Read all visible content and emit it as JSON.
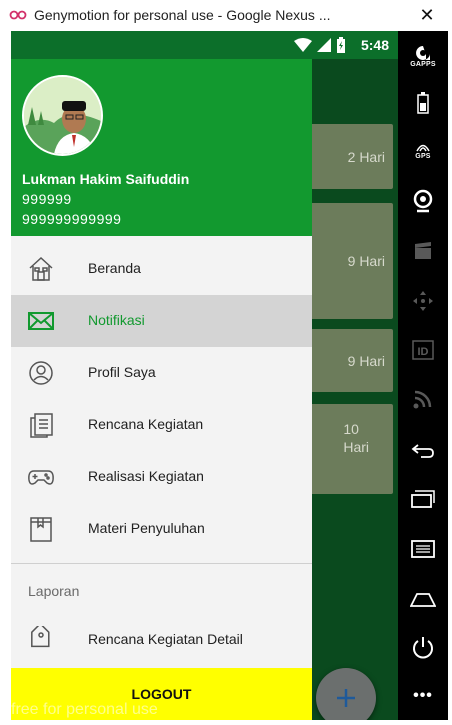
{
  "window": {
    "title": "Genymotion for personal use - Google Nexus ...",
    "close_symbol": "✕"
  },
  "status_bar": {
    "time": "5:48"
  },
  "emulator_panel": {
    "gapps_label": "GAPPS",
    "gps_label": "GPS",
    "id_label": "ID",
    "more_symbol": "•••"
  },
  "background": {
    "cards": [
      {
        "text": "2 Hari"
      },
      {
        "text": "9 Hari"
      },
      {
        "text": "9 Hari"
      },
      {
        "text": "10\nHari"
      }
    ],
    "fab_symbol": "+"
  },
  "drawer": {
    "user": {
      "name": "Lukman Hakim Saifuddin",
      "line1": "999999",
      "line2": "999999999999"
    },
    "menu": [
      {
        "label": "Beranda",
        "icon": "home-icon",
        "active": false
      },
      {
        "label": "Notifikasi",
        "icon": "mail-icon",
        "active": true
      },
      {
        "label": "Profil Saya",
        "icon": "profile-icon",
        "active": false
      },
      {
        "label": "Rencana Kegiatan",
        "icon": "documents-icon",
        "active": false
      },
      {
        "label": "Realisasi Kegiatan",
        "icon": "gamepad-icon",
        "active": false
      },
      {
        "label": "Materi Penyuluhan",
        "icon": "book-icon",
        "active": false
      }
    ],
    "section_label": "Laporan",
    "report_item": {
      "label": "Rencana Kegiatan Detail",
      "icon": "tag-icon"
    },
    "logout_label": "LOGOUT"
  },
  "watermark": "free for personal use",
  "colors": {
    "header_green": "#12992f",
    "status_green": "#0c6f2a",
    "active_text": "#12992f",
    "logout_yellow": "#ffff00"
  }
}
